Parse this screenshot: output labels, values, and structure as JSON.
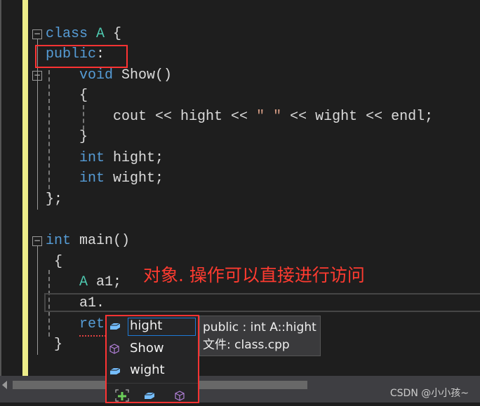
{
  "code": {
    "l1": {
      "kw": "class ",
      "ty": "A",
      "rest": " {"
    },
    "l2": {
      "kw": "public",
      "rest": ":"
    },
    "l3": {
      "kw": "    void ",
      "fn": "Show",
      "rest": "()"
    },
    "l4": "    {",
    "l5": {
      "pre": "        cout << hight << ",
      "st": "\" \"",
      "post": " << wight << endl;"
    },
    "l6": "    }",
    "l7": {
      "kw": "    int ",
      "rest": "hight;"
    },
    "l8": {
      "kw": "    int ",
      "rest": "wight;"
    },
    "l9": "};",
    "l11": {
      "kw": "int ",
      "fn": "main",
      "rest": "()"
    },
    "l12": " {",
    "l13": {
      "ty": "    A ",
      "rest": "a1;"
    },
    "l14": "    a1.",
    "l15": {
      "kw": "    ret"
    },
    "l16": " }"
  },
  "annotation": "对象. 操作可以直接进行访问",
  "completion": {
    "items": [
      {
        "label": "hight",
        "icon": "field-icon",
        "selected": true
      },
      {
        "label": "Show",
        "icon": "method-icon",
        "selected": false
      },
      {
        "label": "wight",
        "icon": "field-icon",
        "selected": false
      }
    ],
    "filters": [
      "expand-filter-icon",
      "field-filter-icon",
      "method-filter-icon"
    ]
  },
  "tooltip": {
    "signature": "public : int A::hight",
    "file": "文件: class.cpp"
  },
  "watermark": "CSDN @小小孩~",
  "colors": {
    "highlight": "#ff3333",
    "keyword": "#569cd6",
    "type": "#4ec9b0",
    "field": "#75beff",
    "method": "#b180d7"
  }
}
